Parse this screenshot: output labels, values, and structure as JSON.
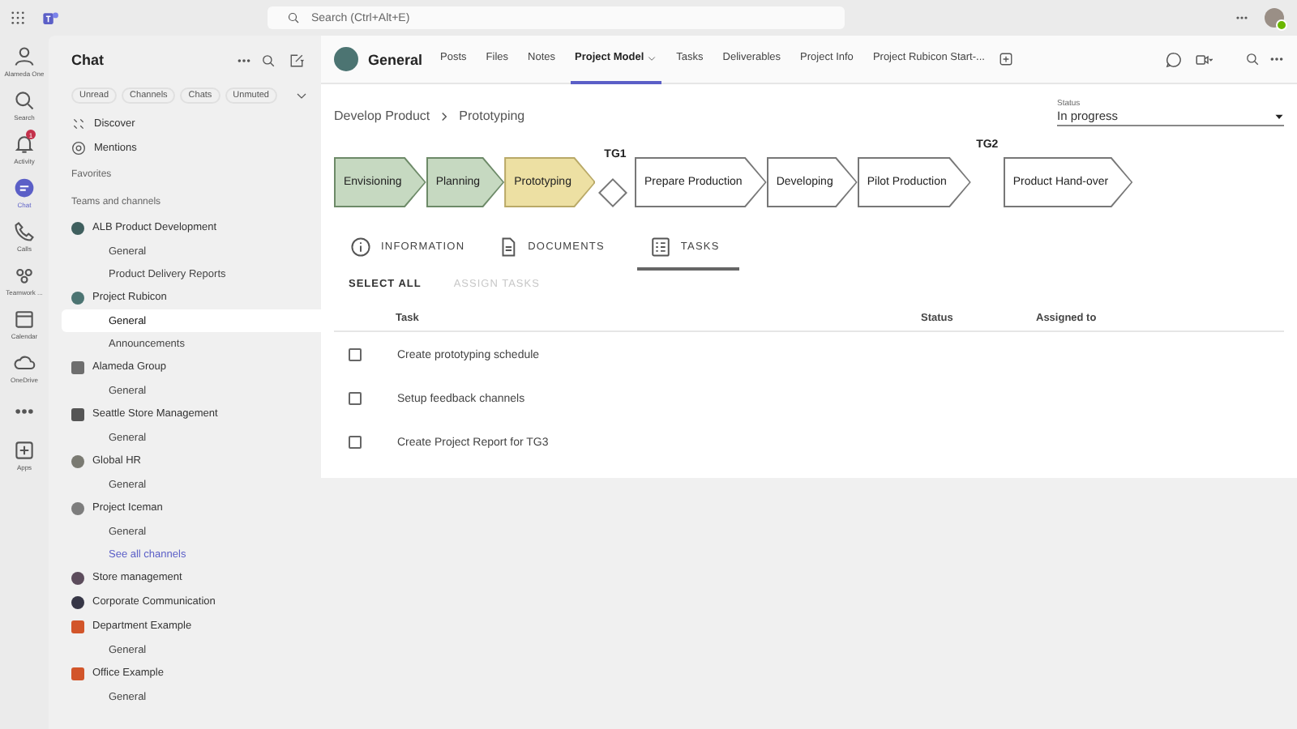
{
  "app_bar": {
    "search": {
      "placeholder": "Search (Ctrl+Alt+E)"
    }
  },
  "rail": [
    {
      "kind": "org",
      "label": "Alameda One",
      "selected": false
    },
    {
      "kind": "search",
      "label": "Search",
      "selected": false
    },
    {
      "kind": "activity",
      "label": "Activity",
      "selected": false,
      "badge": "1"
    },
    {
      "kind": "chat",
      "label": "Chat",
      "selected": true
    },
    {
      "kind": "calls",
      "label": "Calls",
      "selected": false
    },
    {
      "kind": "teamwork",
      "label": "Teamwork ...",
      "selected": false
    },
    {
      "kind": "calendar",
      "label": "Calendar",
      "selected": false
    },
    {
      "kind": "onedrive",
      "label": "OneDrive",
      "selected": false
    },
    {
      "kind": "more",
      "selected": false
    },
    {
      "kind": "apps",
      "label": "Apps",
      "selected": false
    }
  ],
  "chat_panel": {
    "title": "Chat",
    "filters": [
      {
        "label": "Unread",
        "selected": false
      },
      {
        "label": "Channels",
        "selected": false
      },
      {
        "label": "Chats",
        "selected": false
      },
      {
        "label": "Unmuted",
        "selected": false
      }
    ],
    "nav": [
      {
        "kind": "discover",
        "label": "Discover"
      },
      {
        "kind": "mentions",
        "label": "Mentions"
      }
    ],
    "sections": [
      "Favorites",
      "Teams and channels"
    ],
    "teams": [
      {
        "name": "ALB Product Development",
        "color": "#3f5f5e",
        "kind": "circle",
        "children": [
          {
            "kind": "channel",
            "label": "General",
            "selected": false
          },
          {
            "kind": "channel",
            "label": "Product Delivery Reports",
            "selected": false
          }
        ]
      },
      {
        "name": "Project Rubicon",
        "color": "#4c7472",
        "kind": "circle",
        "children": [
          {
            "kind": "channel",
            "label": "General",
            "selected": true
          },
          {
            "kind": "channel",
            "label": "Announcements",
            "selected": false
          }
        ]
      },
      {
        "name": "Alameda Group",
        "color": "#6e6e6e",
        "kind": "square",
        "children": [
          {
            "kind": "channel",
            "label": "General",
            "selected": false
          }
        ]
      },
      {
        "name": "Seattle Store Management",
        "color": "#555555",
        "kind": "square",
        "children": [
          {
            "kind": "channel",
            "label": "General",
            "selected": false
          }
        ]
      },
      {
        "name": "Global HR",
        "color": "#7a7a72",
        "kind": "circle",
        "children": [
          {
            "kind": "channel",
            "label": "General",
            "selected": false
          }
        ]
      },
      {
        "name": "Project Iceman",
        "color": "#7d7d7d",
        "kind": "circle",
        "children": [
          {
            "kind": "channel",
            "label": "General",
            "selected": false
          },
          {
            "kind": "link",
            "label": "See all channels",
            "selected": false
          }
        ]
      },
      {
        "name": "Store management",
        "color": "#5c4c5c",
        "kind": "circle"
      },
      {
        "name": "Corporate Communication",
        "color": "#363646",
        "kind": "circle"
      },
      {
        "name": "Department Example",
        "color": "#d2552a",
        "kind": "square",
        "children": [
          {
            "kind": "channel",
            "label": "General",
            "selected": false
          }
        ]
      },
      {
        "name": "Office Example",
        "color": "#d2552a",
        "kind": "square",
        "children": [
          {
            "kind": "channel",
            "label": "General",
            "selected": false
          }
        ]
      }
    ]
  },
  "channel_header": {
    "title": "General",
    "tabs": [
      {
        "label": "Posts",
        "selected": false,
        "dropdown": false
      },
      {
        "label": "Files",
        "selected": false,
        "dropdown": false
      },
      {
        "label": "Notes",
        "selected": false,
        "dropdown": false
      },
      {
        "label": "Project Model",
        "selected": true,
        "dropdown": true
      },
      {
        "label": "Tasks",
        "selected": false,
        "dropdown": false
      },
      {
        "label": "Deliverables",
        "selected": false,
        "dropdown": false
      },
      {
        "label": "Project Info",
        "selected": false,
        "dropdown": false
      },
      {
        "label": "Project Rubicon Start-...",
        "selected": false,
        "dropdown": false
      }
    ]
  },
  "breadcrumb": [
    "Develop Product",
    "Prototyping"
  ],
  "status_field": {
    "label": "Status",
    "value": "In progress"
  },
  "process": [
    {
      "kind": "stage",
      "label": "Envisioning",
      "completed": true,
      "current": false
    },
    {
      "kind": "stage",
      "label": "Planning",
      "completed": true,
      "current": false
    },
    {
      "kind": "stage",
      "label": "Prototyping",
      "completed": false,
      "current": true
    },
    {
      "kind": "gate",
      "label": "TG1"
    },
    {
      "kind": "stage",
      "label": "Prepare Production",
      "completed": false,
      "current": false
    },
    {
      "kind": "stage",
      "label": "Developing",
      "completed": false,
      "current": false
    },
    {
      "kind": "stage",
      "label": "Pilot Production",
      "completed": false,
      "current": false
    },
    {
      "kind": "milestone",
      "label": "TG2"
    },
    {
      "kind": "stage",
      "label": "Product Hand-over",
      "completed": false,
      "current": false
    }
  ],
  "detail_tabs": [
    {
      "kind": "info",
      "label": "INFORMATION",
      "selected": false
    },
    {
      "kind": "documents",
      "label": "DOCUMENTS",
      "selected": false
    },
    {
      "kind": "tasks",
      "label": "TASKS",
      "selected": true
    }
  ],
  "actions": [
    {
      "label": "SELECT ALL",
      "disabled": false
    },
    {
      "label": "ASSIGN TASKS",
      "disabled": true
    }
  ],
  "table": {
    "columns": [
      "Task",
      "Status",
      "Assigned to"
    ],
    "rows": [
      {
        "task": "Create prototyping schedule",
        "checked": false
      },
      {
        "task": "Setup feedback channels",
        "checked": false
      },
      {
        "task": "Create Project Report for TG3",
        "checked": false
      }
    ]
  }
}
